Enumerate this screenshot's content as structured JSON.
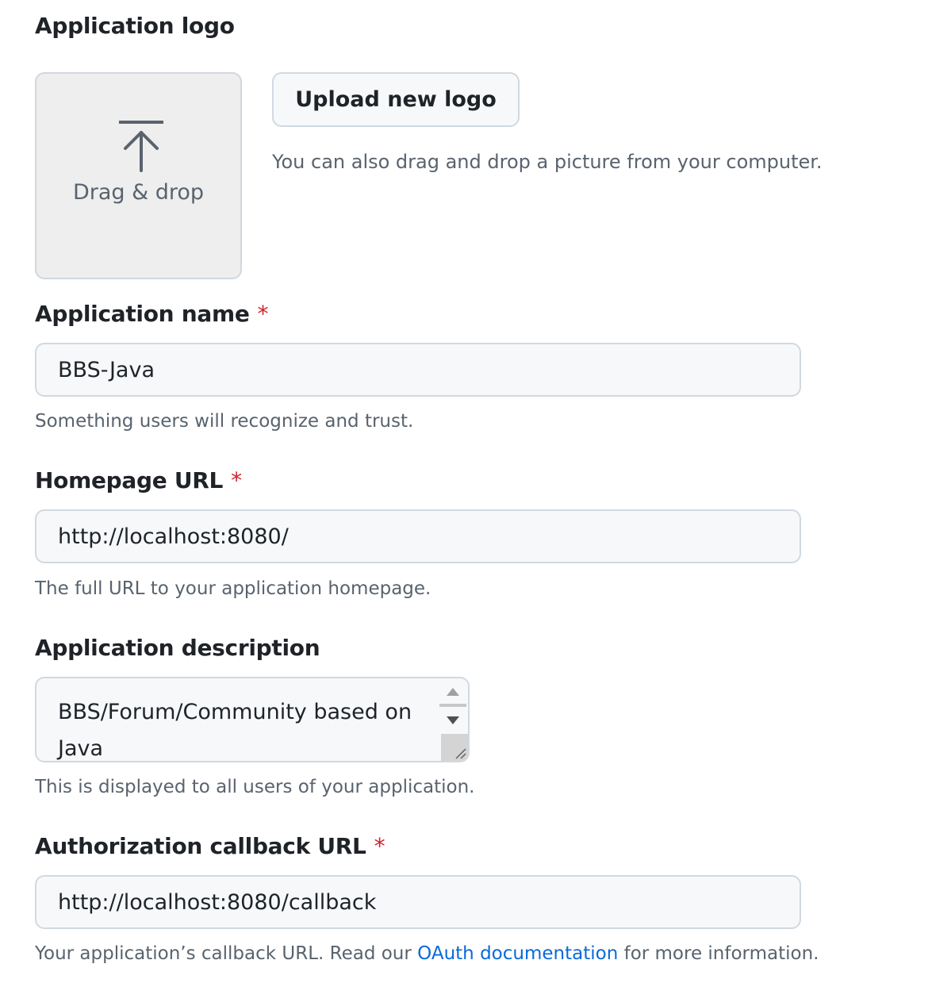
{
  "logo_section": {
    "label": "Application logo",
    "dropzone_text": "Drag & drop",
    "upload_button": "Upload new logo",
    "upload_hint": "You can also drag and drop a picture from your computer."
  },
  "name_field": {
    "label": "Application name",
    "required_marker": "*",
    "value": "BBS-Java",
    "hint": "Something users will recognize and trust."
  },
  "homepage_field": {
    "label": "Homepage URL",
    "required_marker": "*",
    "value": "http://localhost:8080/",
    "hint": "The full URL to your application homepage."
  },
  "description_field": {
    "label": "Application description",
    "value": "BBS/Forum/Community based on Java",
    "hint": "This is displayed to all users of your application."
  },
  "callback_field": {
    "label": "Authorization callback URL",
    "required_marker": "*",
    "value": "http://localhost:8080/callback",
    "hint_prefix": "Your application’s callback URL. Read our ",
    "hint_link": "OAuth documentation",
    "hint_suffix": " for more information."
  },
  "icons": {
    "upload": "upload-arrow-icon",
    "scroll_up": "scroll-up-arrow-icon",
    "scroll_down": "scroll-down-arrow-icon",
    "resize": "resize-grip-icon"
  },
  "colors": {
    "required": "#cf222e",
    "link": "#0969da",
    "input_background": "#f6f8fa",
    "input_border": "#d1d9e0",
    "dropzone_background": "#eeeeee",
    "muted_text": "#59636e"
  }
}
